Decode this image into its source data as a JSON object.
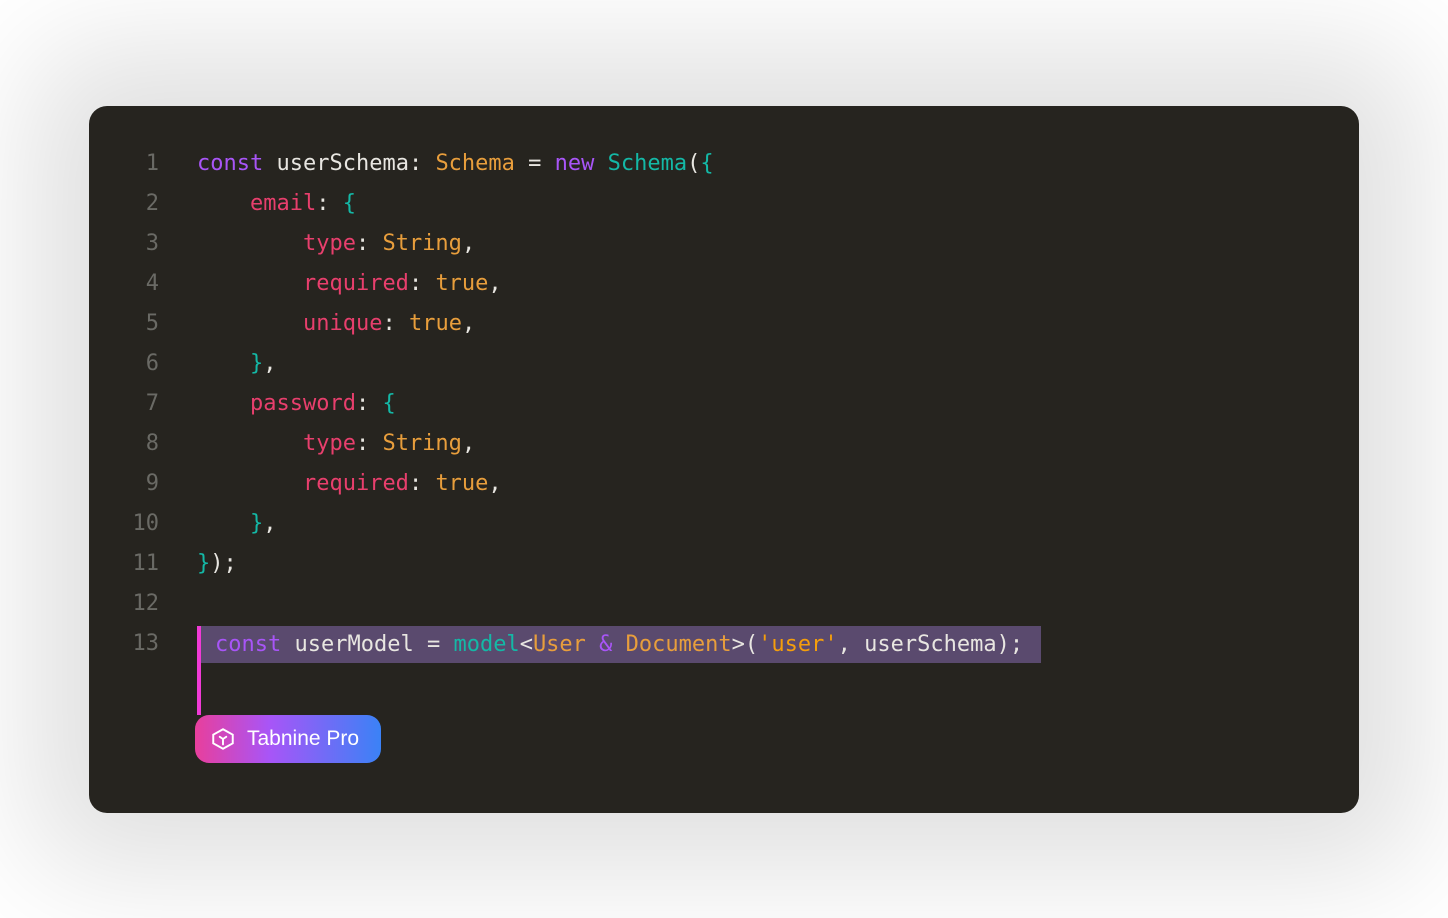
{
  "editor": {
    "lines": [
      {
        "num": "1"
      },
      {
        "num": "2"
      },
      {
        "num": "3"
      },
      {
        "num": "4"
      },
      {
        "num": "5"
      },
      {
        "num": "6"
      },
      {
        "num": "7"
      },
      {
        "num": "8"
      },
      {
        "num": "9"
      },
      {
        "num": "10"
      },
      {
        "num": "11"
      },
      {
        "num": "12"
      },
      {
        "num": "13"
      }
    ],
    "tokens": {
      "l1": {
        "kw1": "const",
        "var1": "userSchema",
        "colon": ":",
        "type1": "Schema",
        "eq": "=",
        "kw2": "new",
        "type2": "Schema",
        "paren": "(",
        "brace": "{"
      },
      "l2": {
        "prop": "email",
        "colon": ": ",
        "brace": "{"
      },
      "l3": {
        "prop": "type",
        "colon": ": ",
        "val": "String",
        "comma": ","
      },
      "l4": {
        "prop": "required",
        "colon": ": ",
        "val": "true",
        "comma": ","
      },
      "l5": {
        "prop": "unique",
        "colon": ": ",
        "val": "true",
        "comma": ","
      },
      "l6": {
        "brace": "}",
        "comma": ","
      },
      "l7": {
        "prop": "password",
        "colon": ": ",
        "brace": "{"
      },
      "l8": {
        "prop": "type",
        "colon": ": ",
        "val": "String",
        "comma": ","
      },
      "l9": {
        "prop": "required",
        "colon": ": ",
        "val": "true",
        "comma": ","
      },
      "l10": {
        "brace": "}",
        "comma": ","
      },
      "l11": {
        "brace": "}",
        "paren": ")",
        "semi": ";"
      },
      "l13": {
        "kw1": "const",
        "var1": "userModel",
        "eq": "=",
        "fn": "model",
        "lt": "<",
        "t1": "User",
        "amp": "&",
        "t2": "Document",
        "gt": ">",
        "paren1": "(",
        "str": "'user'",
        "comma": ",",
        "arg": "userSchema",
        "paren2": ")",
        "semi": ";"
      }
    }
  },
  "badge": {
    "label": "Tabnine Pro"
  }
}
